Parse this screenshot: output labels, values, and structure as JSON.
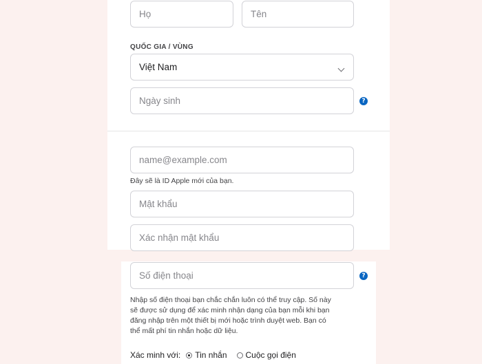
{
  "form": {
    "last_name_placeholder": "Họ",
    "first_name_placeholder": "Tên",
    "country_label": "QUỐC GIA / VÙNG",
    "country_value": "Việt Nam",
    "birthday_placeholder": "Ngày sinh",
    "email_placeholder": "name@example.com",
    "email_hint": "Đây sẽ là ID Apple mới của bạn.",
    "password_placeholder": "Mật khẩu",
    "confirm_password_placeholder": "Xác nhận mật khẩu",
    "phone_placeholder": "Số điện thoại",
    "phone_hint_lines": [
      "Nhập số điện thoại bạn chắc chắn luôn có thể truy cập. Số này",
      "sẽ được sử dụng để xác minh nhận dạng của bạn mỗi khi bạn",
      "đăng nhập trên một thiết bị mới hoặc trình duyệt web. Bạn có",
      "thể mất phí tin nhắn hoặc dữ liệu."
    ],
    "verify_label": "Xác minh với:",
    "verify_options": [
      "Tin nhắn",
      "Cuộc gọi điện"
    ],
    "verify_selected": "Tin nhắn",
    "help_glyph": "?"
  },
  "colors": {
    "page_background": "#fcf1ef",
    "field_border": "#d2d2d7",
    "help_icon": "#0a66c2"
  }
}
